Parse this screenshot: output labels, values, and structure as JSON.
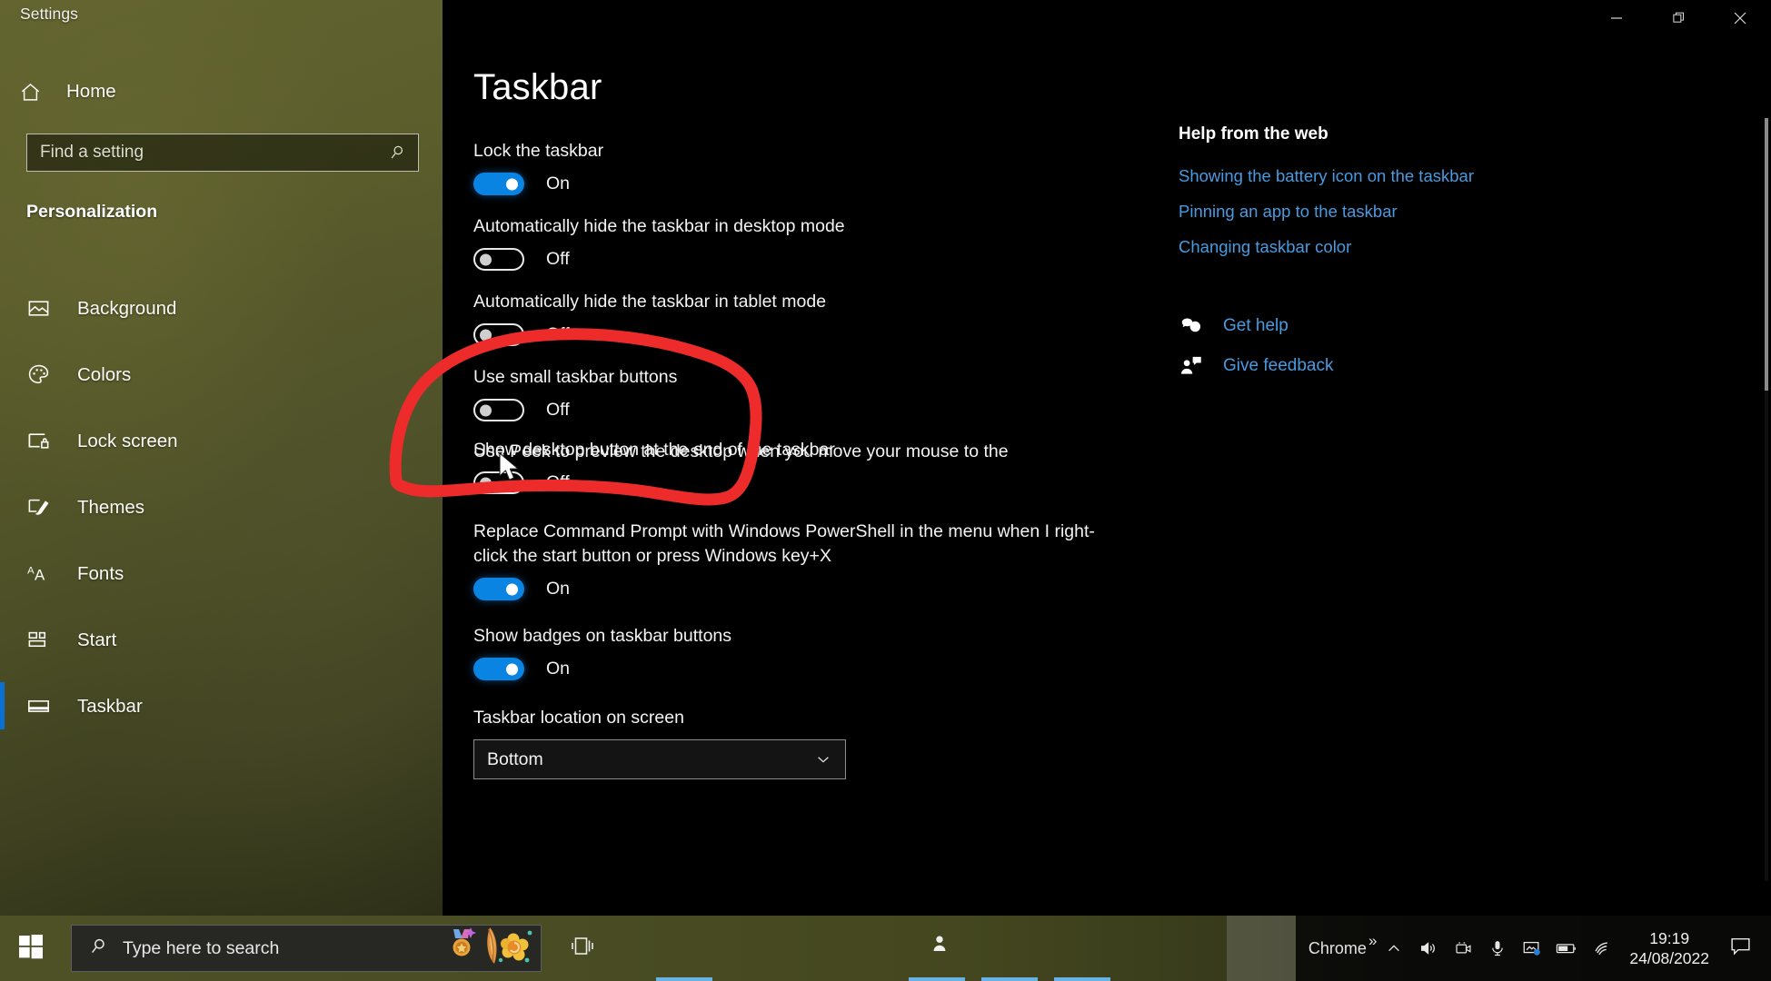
{
  "window": {
    "title": "Settings",
    "controls": [
      {
        "name": "minimize",
        "glyph": "minimize-icon"
      },
      {
        "name": "restore",
        "glyph": "restore-icon"
      },
      {
        "name": "close",
        "glyph": "close-icon"
      }
    ]
  },
  "sidebar": {
    "home_label": "Home",
    "home_icon": "home-icon",
    "search": {
      "placeholder": "Find a setting",
      "icon": "search-icon"
    },
    "category": "Personalization",
    "items": [
      {
        "label": "Background",
        "icon": "picture-icon",
        "selected": false
      },
      {
        "label": "Colors",
        "icon": "palette-icon",
        "selected": false
      },
      {
        "label": "Lock screen",
        "icon": "lock-screen-icon",
        "selected": false
      },
      {
        "label": "Themes",
        "icon": "brush-icon",
        "selected": false
      },
      {
        "label": "Fonts",
        "icon": "fonts-icon",
        "selected": false
      },
      {
        "label": "Start",
        "icon": "start-tiles-icon",
        "selected": false
      },
      {
        "label": "Taskbar",
        "icon": "taskbar-icon",
        "selected": true
      }
    ]
  },
  "main": {
    "page_title": "Taskbar",
    "settings": [
      {
        "label": "Lock the taskbar",
        "state": "On",
        "on": true
      },
      {
        "label": "Automatically hide the taskbar in desktop mode",
        "state": "Off",
        "on": false
      },
      {
        "label": "Automatically hide the taskbar in tablet mode",
        "state": "Off",
        "on": false
      },
      {
        "label": "Use small taskbar buttons",
        "state": "Off",
        "on": false
      },
      {
        "label": "Use Peek to preview the desktop when you move your mouse to the",
        "state": "",
        "on": false,
        "no_toggle": true
      },
      {
        "label": "Show desktop button at the end of the taskbar",
        "state": "Off",
        "on": false,
        "overlap": true
      },
      {
        "label": "Replace Command Prompt with Windows PowerShell in the menu when I right-click the start button or press Windows key+X",
        "state": "On",
        "on": true
      },
      {
        "label": "Show badges on taskbar buttons",
        "state": "On",
        "on": true
      }
    ],
    "dropdown_setting": {
      "label": "Taskbar location on screen",
      "value": "Bottom",
      "caret_icon": "chevron-down-icon"
    }
  },
  "help": {
    "title": "Help from the web",
    "links": [
      "Showing the battery icon on the taskbar",
      "Pinning an app to the taskbar",
      "Changing taskbar color"
    ],
    "actions": [
      {
        "label": "Get help",
        "icon": "question-bubble-icon"
      },
      {
        "label": "Give feedback",
        "icon": "feedback-person-icon"
      }
    ]
  },
  "annotation": {
    "type": "hand-drawn-circle",
    "color": "#ee2b2b",
    "target": "Use small taskbar buttons"
  },
  "cursor": {
    "type": "arrow-pointer"
  },
  "taskbar": {
    "start_icon": "windows-logo-icon",
    "search": {
      "placeholder": "Type here to search",
      "icon": "search-icon",
      "sticker_icon": "stickers-icon"
    },
    "taskview_icon": "task-view-icon",
    "people_icon": "people-icon",
    "tray": {
      "app_label": "Chrome",
      "overflow_glyph": "»",
      "icons": [
        "chevron-up-icon",
        "volume-icon",
        "camera-icon",
        "microphone-icon",
        "screenshot-icon",
        "battery-icon",
        "wifi-icon"
      ],
      "clock_time": "19:19",
      "clock_date": "24/08/2022",
      "action_center_icon": "action-center-icon"
    }
  }
}
